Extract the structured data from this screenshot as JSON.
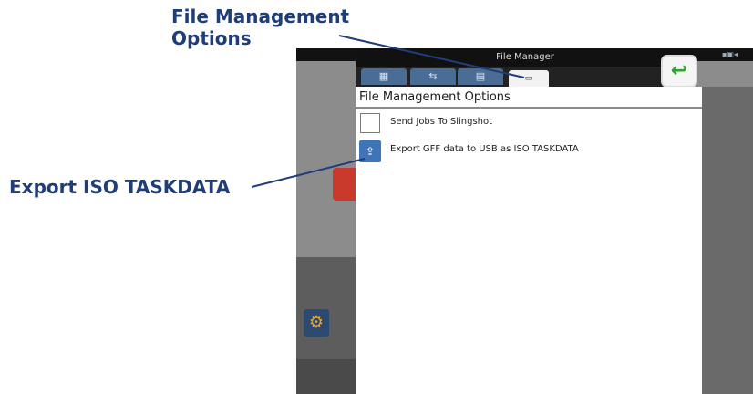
{
  "callouts": {
    "top_line1": "File Management",
    "top_line2": "Options",
    "left": "Export ISO TASKDATA"
  },
  "window": {
    "title": "File Manager",
    "back_icon": "back-arrow-icon",
    "tabs": [
      {
        "icon": "grid-icon",
        "glyph": "▦"
      },
      {
        "icon": "usb-icon",
        "glyph": "⇆"
      },
      {
        "icon": "folder-icon",
        "glyph": "▤"
      },
      {
        "icon": "file-icon",
        "glyph": "▭"
      }
    ]
  },
  "panel": {
    "header": "File Management Options",
    "options": [
      {
        "label": "Send Jobs To Slingshot",
        "icon": "checkbox"
      },
      {
        "label": "Export GFF data to USB as ISO TASKDATA",
        "icon": "export-icon"
      }
    ]
  },
  "colors": {
    "callout_text": "#1f3d78",
    "tab_blue": "#4a6d95",
    "back_green": "#2ba52b"
  }
}
